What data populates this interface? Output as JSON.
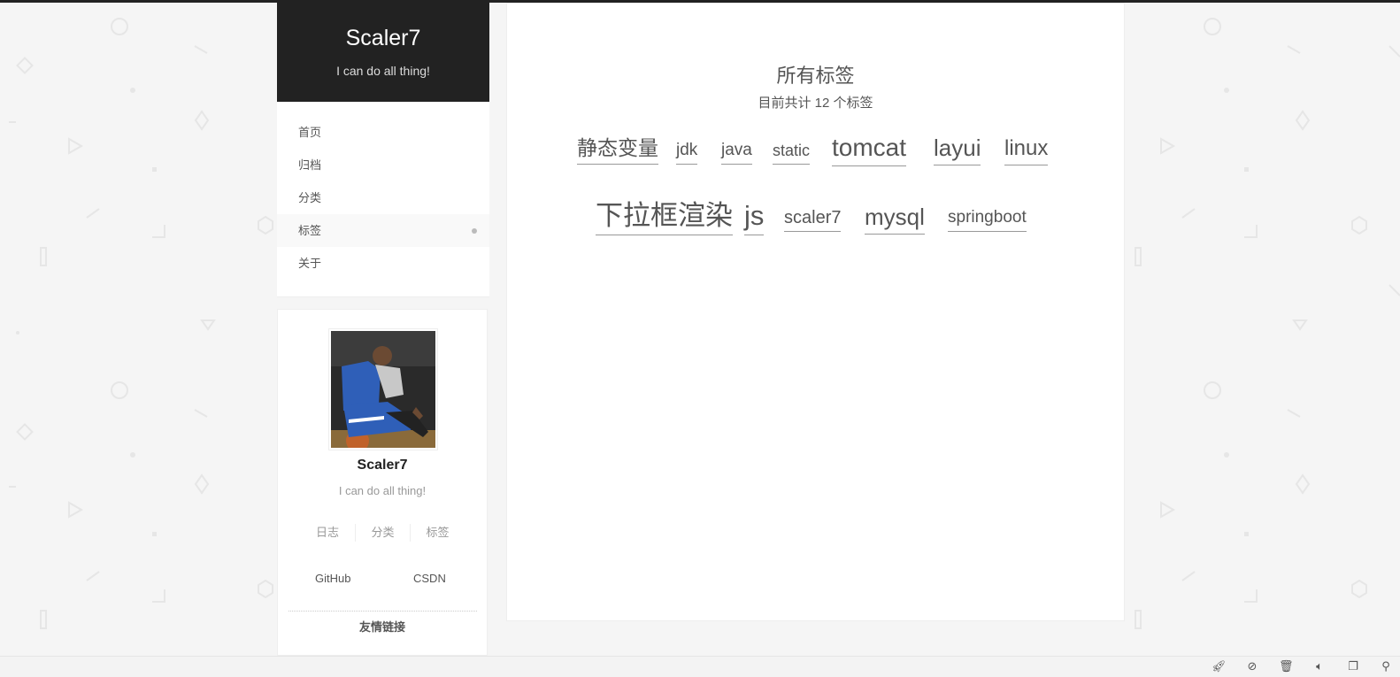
{
  "site": {
    "title": "Scaler7",
    "subtitle": "I can do all thing!"
  },
  "menu": {
    "items": [
      {
        "label": "首页"
      },
      {
        "label": "归档"
      },
      {
        "label": "分类"
      },
      {
        "label": "标签",
        "active": true
      },
      {
        "label": "关于"
      }
    ]
  },
  "profile": {
    "name": "Scaler7",
    "description": "I can do all thing!",
    "stats": [
      {
        "label": "日志"
      },
      {
        "label": "分类"
      },
      {
        "label": "标签"
      }
    ],
    "links": [
      {
        "label": "GitHub"
      },
      {
        "label": "CSDN"
      }
    ],
    "friend_links_title": "友情链接"
  },
  "main": {
    "title": "所有标签",
    "subtitle": "目前共计 12 个标签",
    "tags": [
      {
        "label": "静态变量"
      },
      {
        "label": "jdk"
      },
      {
        "label": "java"
      },
      {
        "label": "static"
      },
      {
        "label": "tomcat"
      },
      {
        "label": "layui"
      },
      {
        "label": "linux"
      },
      {
        "label": "下拉框渲染"
      },
      {
        "label": "js"
      },
      {
        "label": "scaler7"
      },
      {
        "label": "mysql"
      },
      {
        "label": "springboot"
      }
    ]
  },
  "statusbar": {
    "icons": [
      "rocket-icon",
      "no-script-icon",
      "trash-icon",
      "speaker-icon",
      "window-icon",
      "search-icon"
    ]
  },
  "colors": {
    "header_bg": "#222222",
    "page_bg": "#f5f5f5",
    "text": "#555555"
  }
}
